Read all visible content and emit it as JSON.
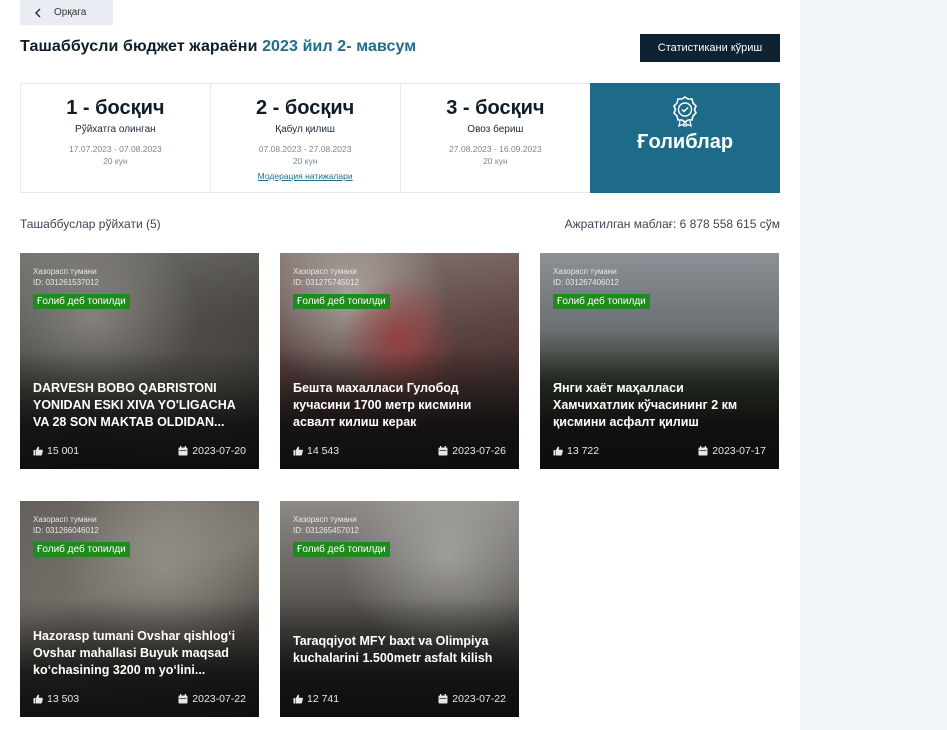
{
  "nav": {
    "back_label": "Орқага"
  },
  "header": {
    "title_main": "Ташаббусли бюджет жараёни",
    "title_accent": "2023 йил 2- мавсум",
    "stats_button": "Статистикани кўриш"
  },
  "stages": [
    {
      "title": "1 - босқич",
      "subtitle": "Рўйхатга олинган",
      "dates": "17.07.2023 - 07.08.2023",
      "days": "20 кун"
    },
    {
      "title": "2 - босқич",
      "subtitle": "Қабул қилиш",
      "dates": "07.08.2023 - 27.08.2023",
      "days": "20 кун",
      "link": "Модерация натижалари"
    },
    {
      "title": "3 - босқич",
      "subtitle": "Овоз бериш",
      "dates": "27.08.2023 - 16.09.2023",
      "days": "20 кун"
    }
  ],
  "winners": {
    "label": "Ғолиблар",
    "icon": "award-badge-icon",
    "color": "#1d6b89"
  },
  "list": {
    "title": "Ташаббуслар рўйхати (5)",
    "budget": "Ажратилган маблағ: 6 878 558 615 сўм"
  },
  "cards": [
    {
      "district": "Хазорасп тумани",
      "id": "ID: 031261537012",
      "badge": "Ғолиб деб топилди",
      "title": "DARVESH BOBO QABRISTONI YONIDAN ESKI XIVA YO'LIGACHA VA 28 SON MAKTAB OLDIDAN...",
      "likes": "15 001",
      "date": "2023-07-20"
    },
    {
      "district": "Хазорасп тумани",
      "id": "ID: 031275745012",
      "badge": "Ғолиб деб топилди",
      "title": "Бешта махалласи Гулобод кучасини 1700 метр кисмини асвалт килиш керак",
      "likes": "14 543",
      "date": "2023-07-26"
    },
    {
      "district": "Хазорасп тумани",
      "id": "ID: 031267406012",
      "badge": "Ғолиб деб топилди",
      "title": "Янги хаёт маҳалласи Хамчихатлик кўчасининг 2 км қисмини асфалт қилиш",
      "likes": "13 722",
      "date": "2023-07-17"
    },
    {
      "district": "Хазорасп тумани",
      "id": "ID: 031266046012",
      "badge": "Ғолиб деб топилди",
      "title": "Hazorasp tumani Ovshar qishlog‘i Ovshar mahallasi Buyuk maqsad ko‘chasining 3200 m yo‘lini...",
      "likes": "13 503",
      "date": "2023-07-22"
    },
    {
      "district": "Хазорасп тумани",
      "id": "ID: 031265457012",
      "badge": "Ғолиб деб топилди",
      "title": "Taraqqiyot MFY baxt va Olimpiya kuchalarini 1.500metr asfalt kilish",
      "likes": "12 741",
      "date": "2023-07-22"
    }
  ],
  "colors": {
    "accent": "#206d8a",
    "badge": "#1f8b1f",
    "dark_button": "#0d2233"
  }
}
